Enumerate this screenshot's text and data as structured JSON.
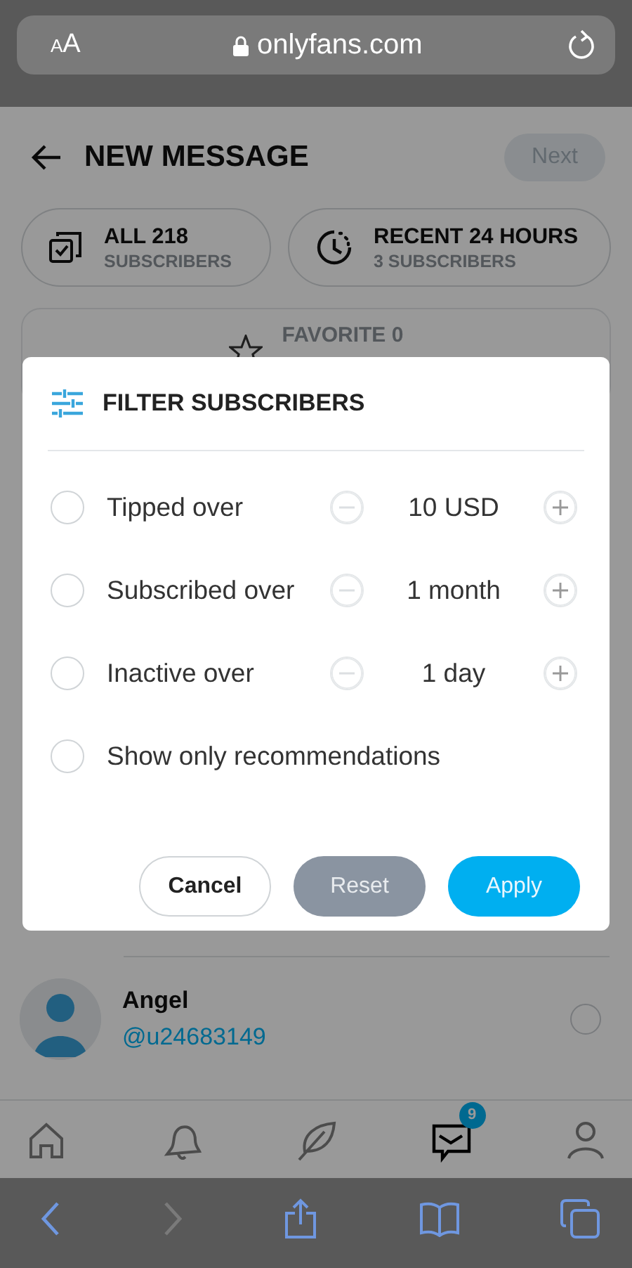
{
  "browser": {
    "text_size": "AA",
    "url": "onlyfans.com"
  },
  "header": {
    "title": "NEW MESSAGE",
    "next_button": {
      "label": "Next",
      "disabled": true
    }
  },
  "lists": [
    {
      "kind": "all",
      "title": "ALL 218",
      "subtitle": "SUBSCRIBERS"
    },
    {
      "kind": "recent",
      "title": "RECENT 24 HOURS",
      "subtitle": "3 SUBSCRIBERS"
    },
    {
      "kind": "favorite",
      "title": "FAVORITE 0"
    }
  ],
  "dialog": {
    "title": "FILTER SUBSCRIBERS",
    "filters": [
      {
        "kind": "stepper",
        "label": "Tipped over",
        "value": "10 USD",
        "checked": false
      },
      {
        "kind": "stepper",
        "label": "Subscribed over",
        "value": "1 month",
        "checked": false
      },
      {
        "kind": "stepper",
        "label": "Inactive over",
        "value": "1 day",
        "checked": false
      },
      {
        "kind": "plain",
        "label": "Show only recommendations",
        "checked": false
      }
    ],
    "buttons": [
      {
        "kind": "outline",
        "label": "Cancel"
      },
      {
        "kind": "grey",
        "label": "Reset"
      },
      {
        "kind": "primary",
        "label": "Apply"
      }
    ]
  },
  "subscribers": [
    {
      "name": "Angel",
      "handle": "@u24683149",
      "selected": false
    }
  ],
  "nav": [
    {
      "kind": "home",
      "selected": false
    },
    {
      "kind": "bell",
      "selected": false
    },
    {
      "kind": "leaf",
      "selected": false
    },
    {
      "kind": "messages",
      "selected": true,
      "badge": "9"
    },
    {
      "kind": "profile",
      "selected": false
    }
  ],
  "safari": [
    {
      "kind": "back",
      "disabled": false
    },
    {
      "kind": "forward",
      "disabled": true
    },
    {
      "kind": "share",
      "disabled": false
    },
    {
      "kind": "bookmarks",
      "disabled": false
    },
    {
      "kind": "tabs",
      "disabled": false
    }
  ]
}
